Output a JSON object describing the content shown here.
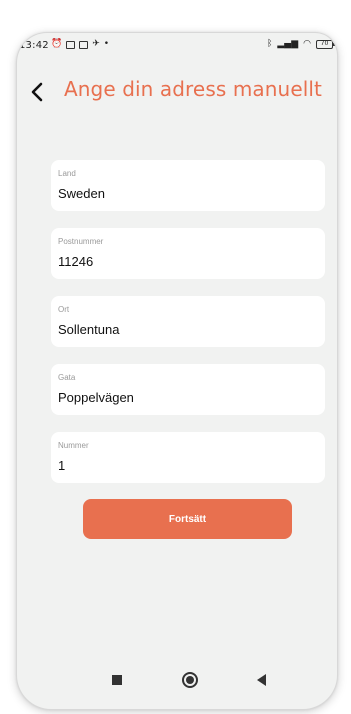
{
  "status_bar": {
    "time": "13:42",
    "left_icons": [
      "alarm-icon",
      "message-icon",
      "gallery-icon",
      "app-icon",
      "dot-icon"
    ],
    "right_icons": [
      "bluetooth-icon",
      "signal-icon",
      "wifi-icon",
      "battery-icon"
    ],
    "battery_level": "70"
  },
  "header": {
    "title": "Ange din adress manuellt",
    "back_icon": "chevron-left-icon"
  },
  "form": {
    "fields": [
      {
        "label": "Land",
        "value": "Sweden"
      },
      {
        "label": "Postnummer",
        "value": "11246"
      },
      {
        "label": "Ort",
        "value": "Sollentuna"
      },
      {
        "label": "Gata",
        "value": "Poppelvägen"
      },
      {
        "label": "Nummer",
        "value": "1"
      }
    ]
  },
  "continue_button": {
    "label": "Fortsätt"
  },
  "nav_bar": {
    "icons": [
      "recents-icon",
      "home-icon",
      "back-icon"
    ]
  },
  "colors": {
    "accent": "#e8704f",
    "background": "#f1f2f1",
    "card": "#ffffff",
    "label": "#9a9a9a",
    "text": "#111111"
  }
}
